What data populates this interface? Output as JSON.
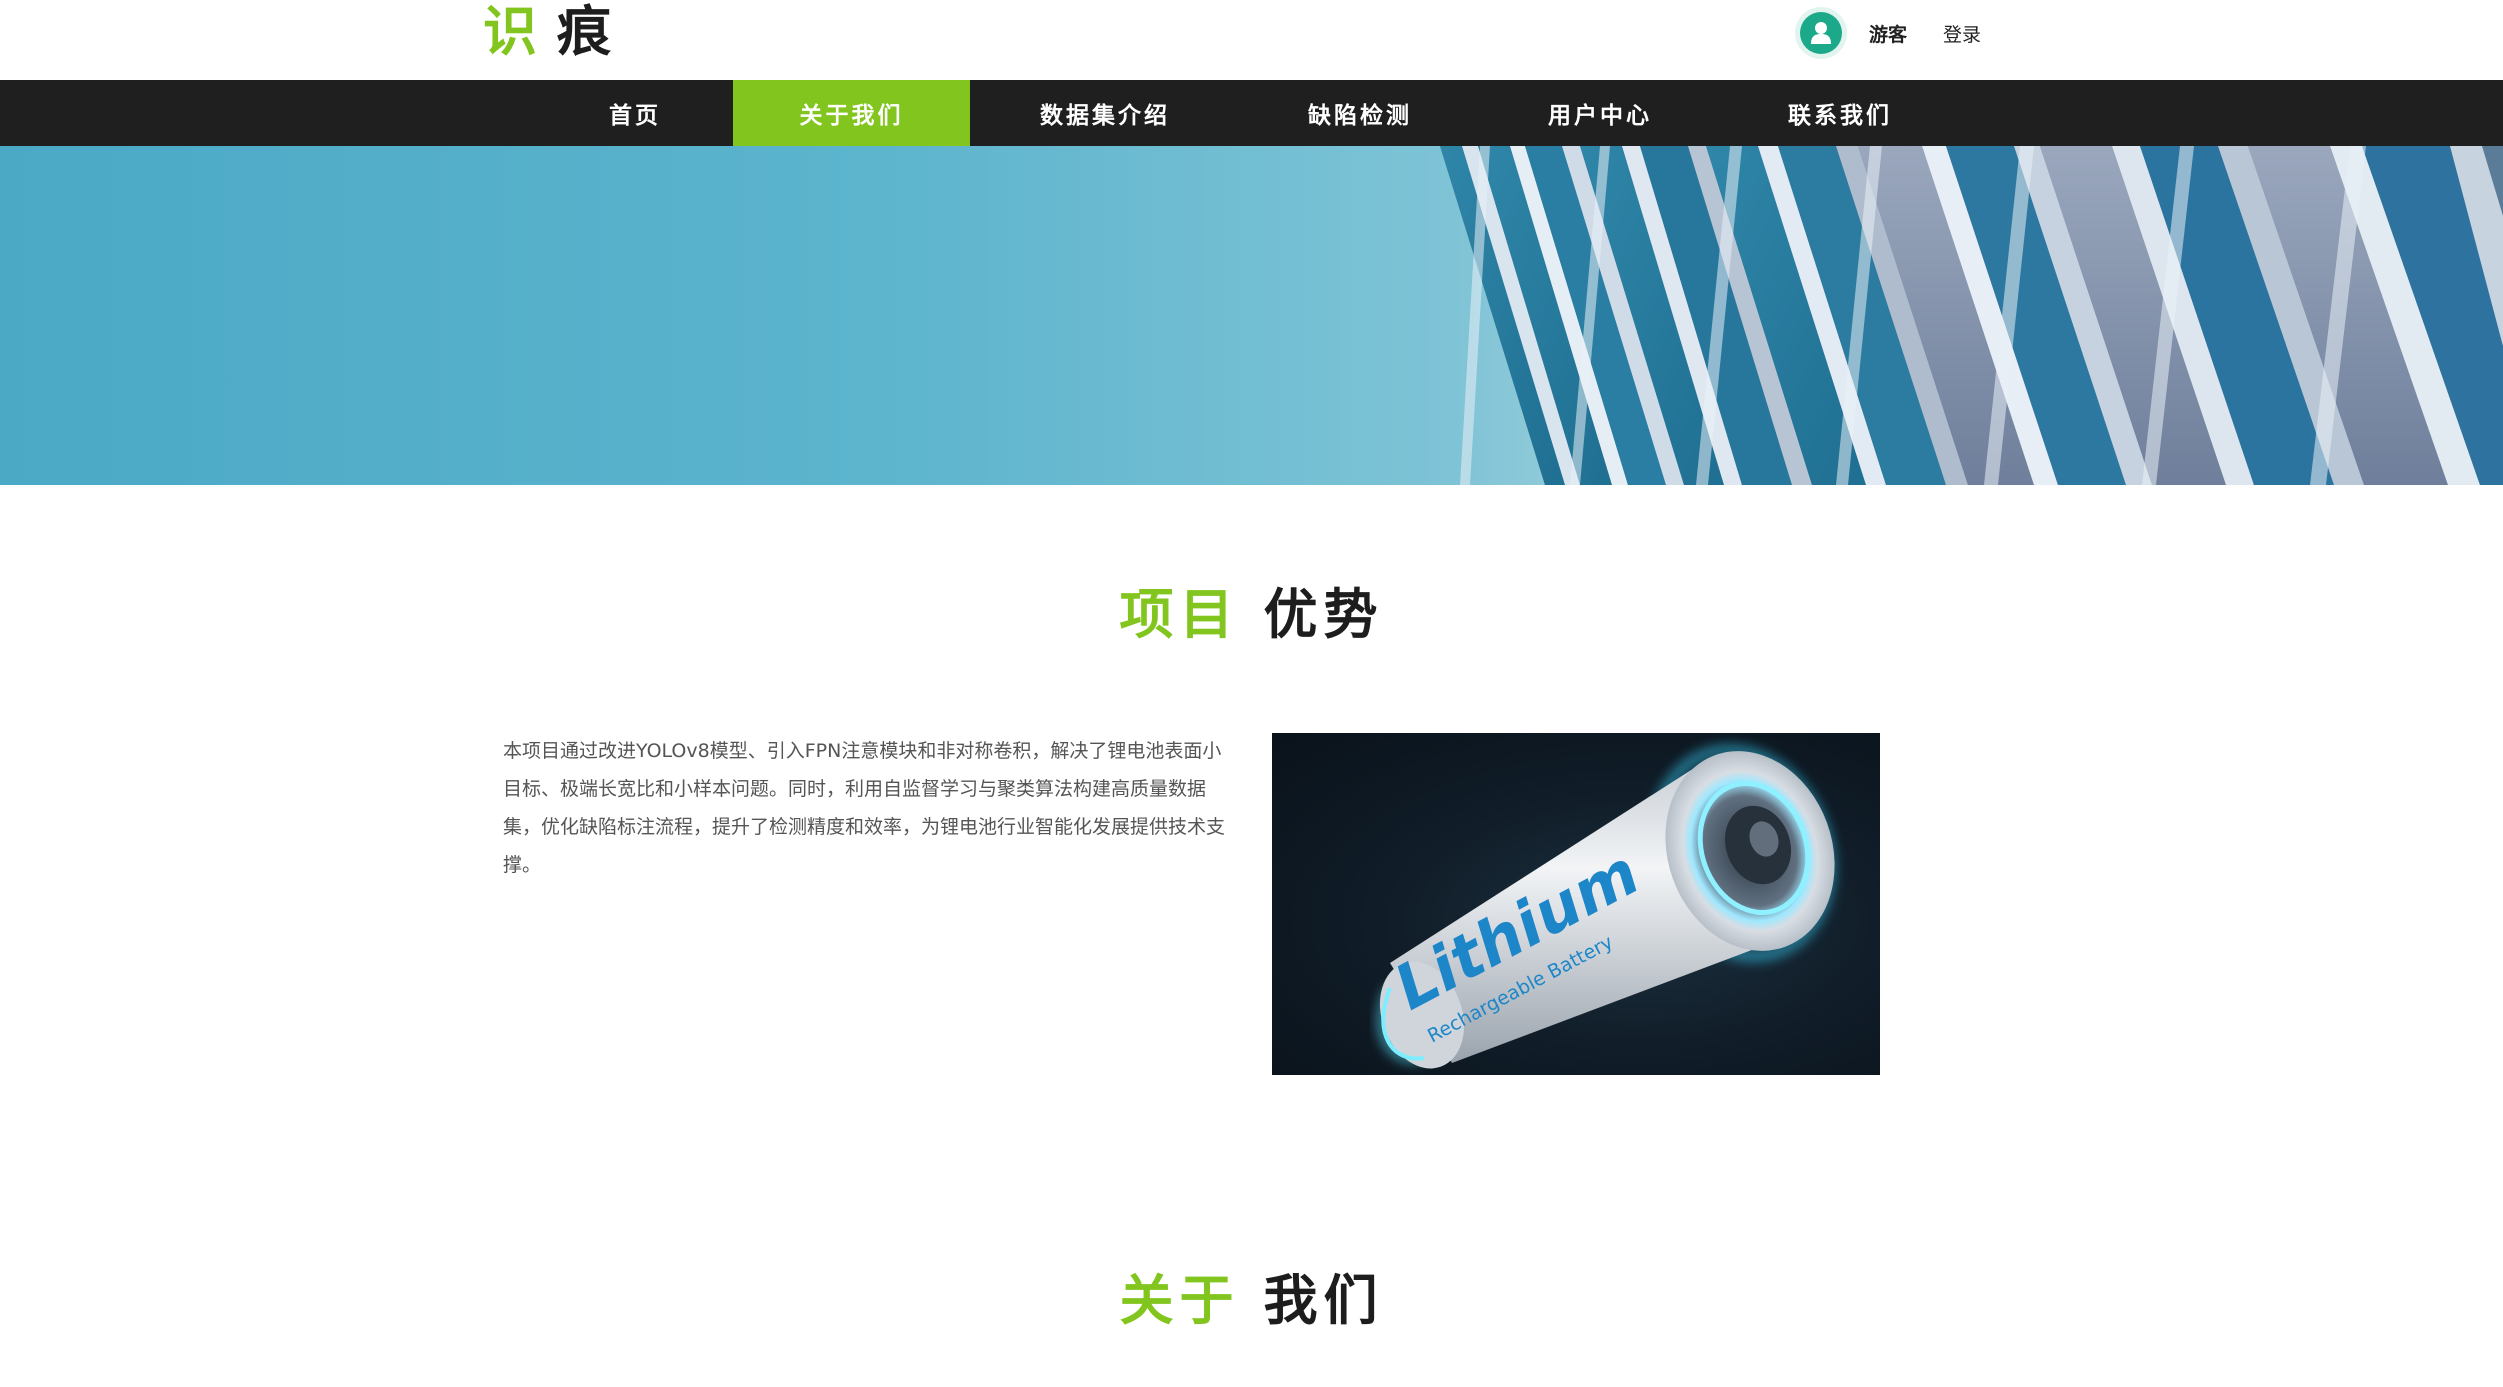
{
  "header": {
    "logo_char_1": "识",
    "logo_char_2": "痕",
    "user_label": "游客",
    "login_label": "登录"
  },
  "nav": {
    "items": [
      {
        "label": "首页",
        "active": false
      },
      {
        "label": "关于我们",
        "active": true
      },
      {
        "label": "数据集介绍",
        "active": false
      },
      {
        "label": "缺陷检测",
        "active": false
      },
      {
        "label": "用户中心",
        "active": false
      },
      {
        "label": "联系我们",
        "active": false
      }
    ]
  },
  "advantage": {
    "title_part_1": "项目",
    "title_part_2": "优势",
    "description": "本项目通过改进YOLOv8模型、引入FPN注意模块和非对称卷积，解决了锂电池表面小目标、极端长宽比和小样本问题。同时，利用自监督学习与聚类算法构建高质量数据集，优化缺陷标注流程，提升了检测精度和效率，为锂电池行业智能化发展提供技术支撑。",
    "image_text_main": "Lithium",
    "image_text_sub": "Rechargeable Battery"
  },
  "about": {
    "title_part_1": "关于",
    "title_part_2": "我们"
  },
  "colors": {
    "accent": "#82c51e",
    "nav_bg": "#1f1f1f",
    "avatar": "#1ba98a"
  }
}
